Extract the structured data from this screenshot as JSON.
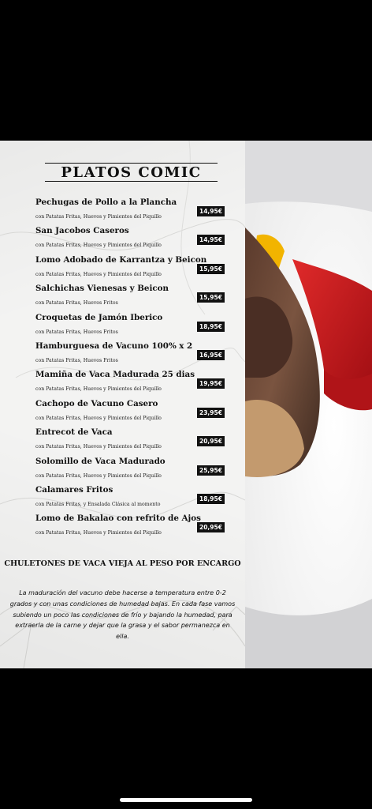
{
  "menu": {
    "title": "PLATOS COMIC",
    "items": [
      {
        "name": "Pechugas de Pollo a la Plancha",
        "desc": "con Patatas Fritas, Huevos y Pimientos del Piquillo",
        "price": "14,95€"
      },
      {
        "name": "San Jacobos Caseros",
        "desc": "con Patatas Fritas, Huevos y Pimientos del Piquillo",
        "price": "14,95€"
      },
      {
        "name": "Lomo Adobado de Karrantza y Beicon",
        "desc": "con Patatas Fritas, Huevos y Pimientos del Piquillo",
        "price": "15,95€"
      },
      {
        "name": "Salchichas Vienesas y Beicon",
        "desc": "con Patatas Fritas, Huevos Fritos",
        "price": "15,95€"
      },
      {
        "name": "Croquetas de Jamón Iberico",
        "desc": "con Patatas Fritas, Huevos Fritos",
        "price": "18,95€"
      },
      {
        "name": "Hamburguesa de Vacuno 100% x 2",
        "desc": "con Patatas Fritas, Huevos Fritos",
        "price": "16,95€"
      },
      {
        "name": "Mamiña de Vaca Madurada 25 dias",
        "desc": "con Patatas Fritas, Huevos y Pimientos del Piquillo",
        "price": "19,95€"
      },
      {
        "name": "Cachopo de Vacuno Casero",
        "desc": "con Patatas Fritas, Huevos y Pimientos del Piquillo",
        "price": "23,95€"
      },
      {
        "name": "Entrecot de Vaca",
        "desc": "con Patatas Fritas, Huevos y Pimientos del Piquillo",
        "price": "20,95€"
      },
      {
        "name": "Solomillo de Vaca Madurado",
        "desc": "con Patatas Fritas, Huevos y Pimientos del Piquillo",
        "price": "25,95€"
      },
      {
        "name": "Calamares Fritos",
        "desc": "con Patatas Fritas, y Ensalada Clásica al momento",
        "price": "18,95€"
      },
      {
        "name": "Lomo de Bakalao con refrito de Ajos",
        "desc": "con Patatas Fritas, Huevos y Pimientos del Piquillo",
        "price": "20,95€"
      }
    ],
    "chuleton_heading": "CHULETONES DE VACA VIEJA AL PESO POR ENCARGO",
    "note": "La maduración del vacuno debe hacerse a temperatura entre 0-2 grados y con unas condiciones de humedad bajas. En cada fase vamos subiendo un poco las condiciones de frío y bajando la humedad, para extraerla de la carne y dejar que la grasa y el sabor permanezca en ella."
  },
  "colors": {
    "price_badge_bg": "#111111",
    "paper": "#f3f3f2",
    "pepper_red": "#c8121a"
  }
}
